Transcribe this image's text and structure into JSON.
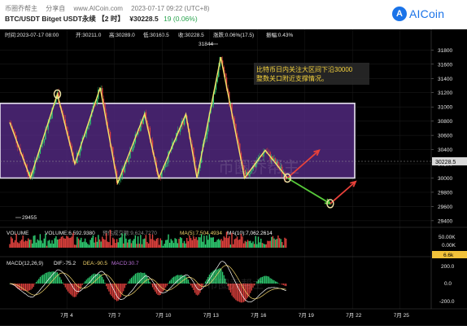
{
  "header": {
    "source": "币圈乔帮主",
    "share": "分享自",
    "site": "www.AICoin.com",
    "timestamp": "2023-07-17 09:22 (UTC+8)",
    "symbol": "BTC/USDT Bitget USDT永续 【2 时】",
    "price": "¥30228.5",
    "change": "19 (0.06%)"
  },
  "logo": {
    "text": "AICoin"
  },
  "ohlc_bar": {
    "time": "时间:2023-07-17 08:00",
    "open": "开:30211.0",
    "high": "高:30289.0",
    "low": "低:30160.5",
    "close": "收:30228.5",
    "change": "涨跌:0.06%(17.5)",
    "amplitude": "振幅:0.43%"
  },
  "annotation": {
    "line1": "比特币日内关注大区间下沿30000",
    "line2": "整数关口附近支撑情况。"
  },
  "price_markers": {
    "high": "31844",
    "low": "29455",
    "current": "30228.5"
  },
  "volume_info": {
    "label": "VOLUME",
    "volume": "VOLUME:6,592.9380",
    "forecast": "预估成交额:9,624.7270",
    "ma5": "MA(5):7,504.4934",
    "ma10": "MA(10):7,062.2614",
    "axis_top": "50.00K",
    "axis_mid": "0.00K",
    "current": "6.6k"
  },
  "macd_info": {
    "label": "MACD(12,26,9)",
    "dif": "DIF:-75.2",
    "dea": "DEA:-90.5",
    "macd": "MACD:30.7",
    "ticks": [
      "200.0",
      "0.0",
      "-200.0"
    ]
  },
  "watermark": "币圈乔帮主",
  "colors": {
    "background": "#000000",
    "up": "#2ecc71",
    "down": "#e0413d",
    "zone_fill": "#5b2d8e",
    "zone_border": "#e8e2f0",
    "zigzag": "#f5e36b",
    "arrow_up": "#e8413a",
    "arrow_down": "#57c93a",
    "annotation_text": "#f5d23c",
    "marker": "#f5e6a8",
    "dif": "#ffffff",
    "dea": "#f2d46b",
    "ma5": "#f2d46b",
    "ma10": "#ffffff"
  },
  "chart_data": {
    "type": "candlestick",
    "x_tick_labels": [
      "7月 4",
      "7月 7",
      "7月 10",
      "7月 13",
      "7月 16",
      "7月 19",
      "7月 22",
      "7月 25"
    ],
    "y_tick_labels": [
      31800,
      31600,
      31400,
      31200,
      31000,
      30800,
      30600,
      30400,
      30200,
      30000,
      29800,
      29600,
      29400
    ],
    "ylim": [
      29330,
      31930
    ],
    "zone": {
      "low": 30000,
      "high": 31050
    },
    "high": 31844,
    "low": 29455,
    "current": 30228.5,
    "zigzag": [
      [
        0,
        30780
      ],
      [
        1.3,
        30000
      ],
      [
        3,
        31180
      ],
      [
        4.1,
        30200
      ],
      [
        5.7,
        31270
      ],
      [
        6.8,
        29930
      ],
      [
        8.5,
        30900
      ],
      [
        9.4,
        30000
      ],
      [
        11.1,
        30900
      ],
      [
        11.8,
        30000
      ],
      [
        13.3,
        31700
      ],
      [
        14.8,
        30000
      ],
      [
        16.1,
        30390
      ],
      [
        17.5,
        30000
      ]
    ],
    "projection_up_1": [
      [
        17.5,
        30000
      ],
      [
        19.5,
        30390
      ]
    ],
    "projection_down": [
      [
        17.5,
        30000
      ],
      [
        20.2,
        29640
      ]
    ],
    "projection_up_2": [
      [
        20.2,
        29640
      ],
      [
        21.8,
        29950
      ]
    ],
    "marker_points": [
      [
        3,
        31180
      ],
      [
        17.5,
        30000
      ],
      [
        20.2,
        29640
      ]
    ]
  }
}
